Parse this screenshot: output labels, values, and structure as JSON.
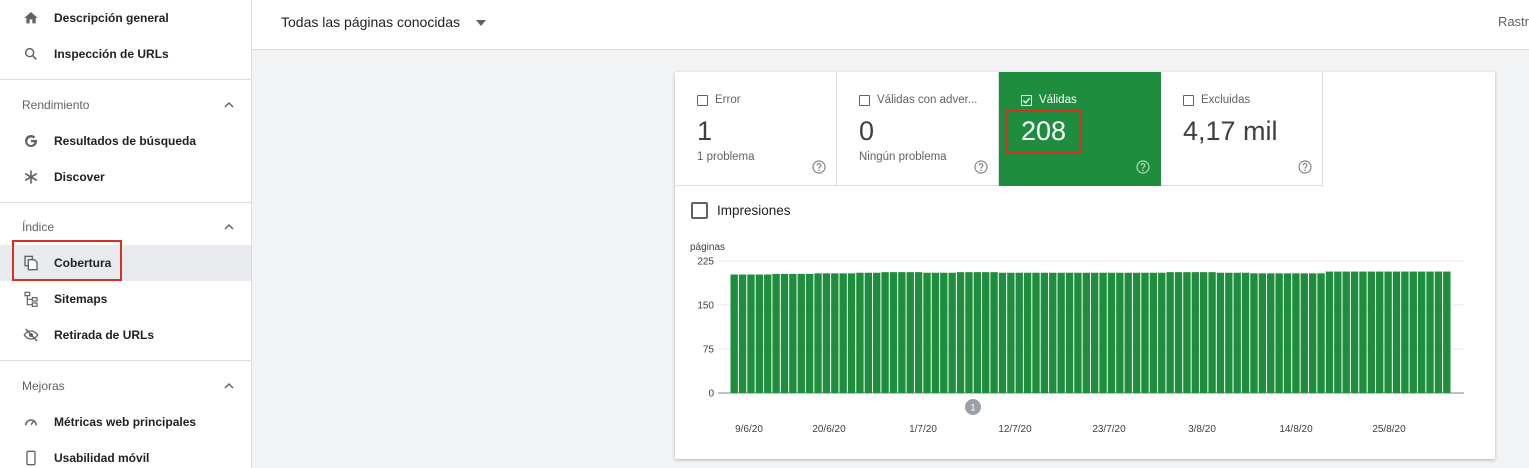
{
  "sidebar": {
    "top_items": [
      {
        "label": "Descripción general",
        "icon": "home-icon"
      },
      {
        "label": "Inspección de URLs",
        "icon": "search-icon"
      }
    ],
    "sections": [
      {
        "title": "Rendimiento",
        "items": [
          {
            "label": "Resultados de búsqueda",
            "icon": "google-g-icon"
          },
          {
            "label": "Discover",
            "icon": "asterisk-icon"
          }
        ]
      },
      {
        "title": "Índice",
        "items": [
          {
            "label": "Cobertura",
            "icon": "copy-pages-icon",
            "active": true
          },
          {
            "label": "Sitemaps",
            "icon": "sitemap-icon"
          },
          {
            "label": "Retirada de URLs",
            "icon": "eye-off-icon"
          }
        ]
      },
      {
        "title": "Mejoras",
        "items": [
          {
            "label": "Métricas web principales",
            "icon": "gauge-icon"
          },
          {
            "label": "Usabilidad móvil",
            "icon": "phone-icon"
          }
        ]
      }
    ]
  },
  "topbar": {
    "filter_label": "Todas las páginas conocidas",
    "right_text": "Rastr"
  },
  "tiles": [
    {
      "label": "Error",
      "value": "1",
      "sub": "1 problema",
      "checked": false
    },
    {
      "label": "Válidas con adver...",
      "value": "0",
      "sub": "Ningún problema",
      "checked": false
    },
    {
      "label": "Válidas",
      "value": "208",
      "sub": "",
      "checked": true
    },
    {
      "label": "Excluidas",
      "value": "4,17 mil",
      "sub": "",
      "checked": false
    }
  ],
  "impressions_label": "Impresiones",
  "colors": {
    "valid_green": "#1e8e3e",
    "highlight_red": "#d93025",
    "bar_green": "#1e8e3e"
  },
  "chart_data": {
    "type": "bar",
    "ylabel": "páginas",
    "ylim": [
      0,
      225
    ],
    "yticks": [
      "225",
      "150",
      "75",
      "0"
    ],
    "x_tick_labels": [
      "9/6/20",
      "20/6/20",
      "1/7/20",
      "12/7/20",
      "23/7/20",
      "3/8/20",
      "14/8/20",
      "25/8/20"
    ],
    "annotation": "1",
    "values": [
      202,
      202,
      202,
      202,
      202,
      203,
      203,
      203,
      203,
      203,
      204,
      204,
      204,
      204,
      204,
      205,
      205,
      205,
      206,
      206,
      206,
      206,
      206,
      205,
      205,
      205,
      205,
      206,
      206,
      206,
      206,
      206,
      205,
      205,
      205,
      205,
      205,
      205,
      205,
      205,
      205,
      205,
      205,
      205,
      205,
      205,
      205,
      205,
      205,
      205,
      205,
      205,
      206,
      206,
      206,
      206,
      206,
      206,
      205,
      205,
      205,
      205,
      204,
      204,
      204,
      204,
      204,
      204,
      204,
      204,
      204,
      207,
      207,
      207,
      207,
      207,
      207,
      207,
      207,
      207,
      207,
      207,
      207,
      207,
      207,
      207
    ]
  }
}
